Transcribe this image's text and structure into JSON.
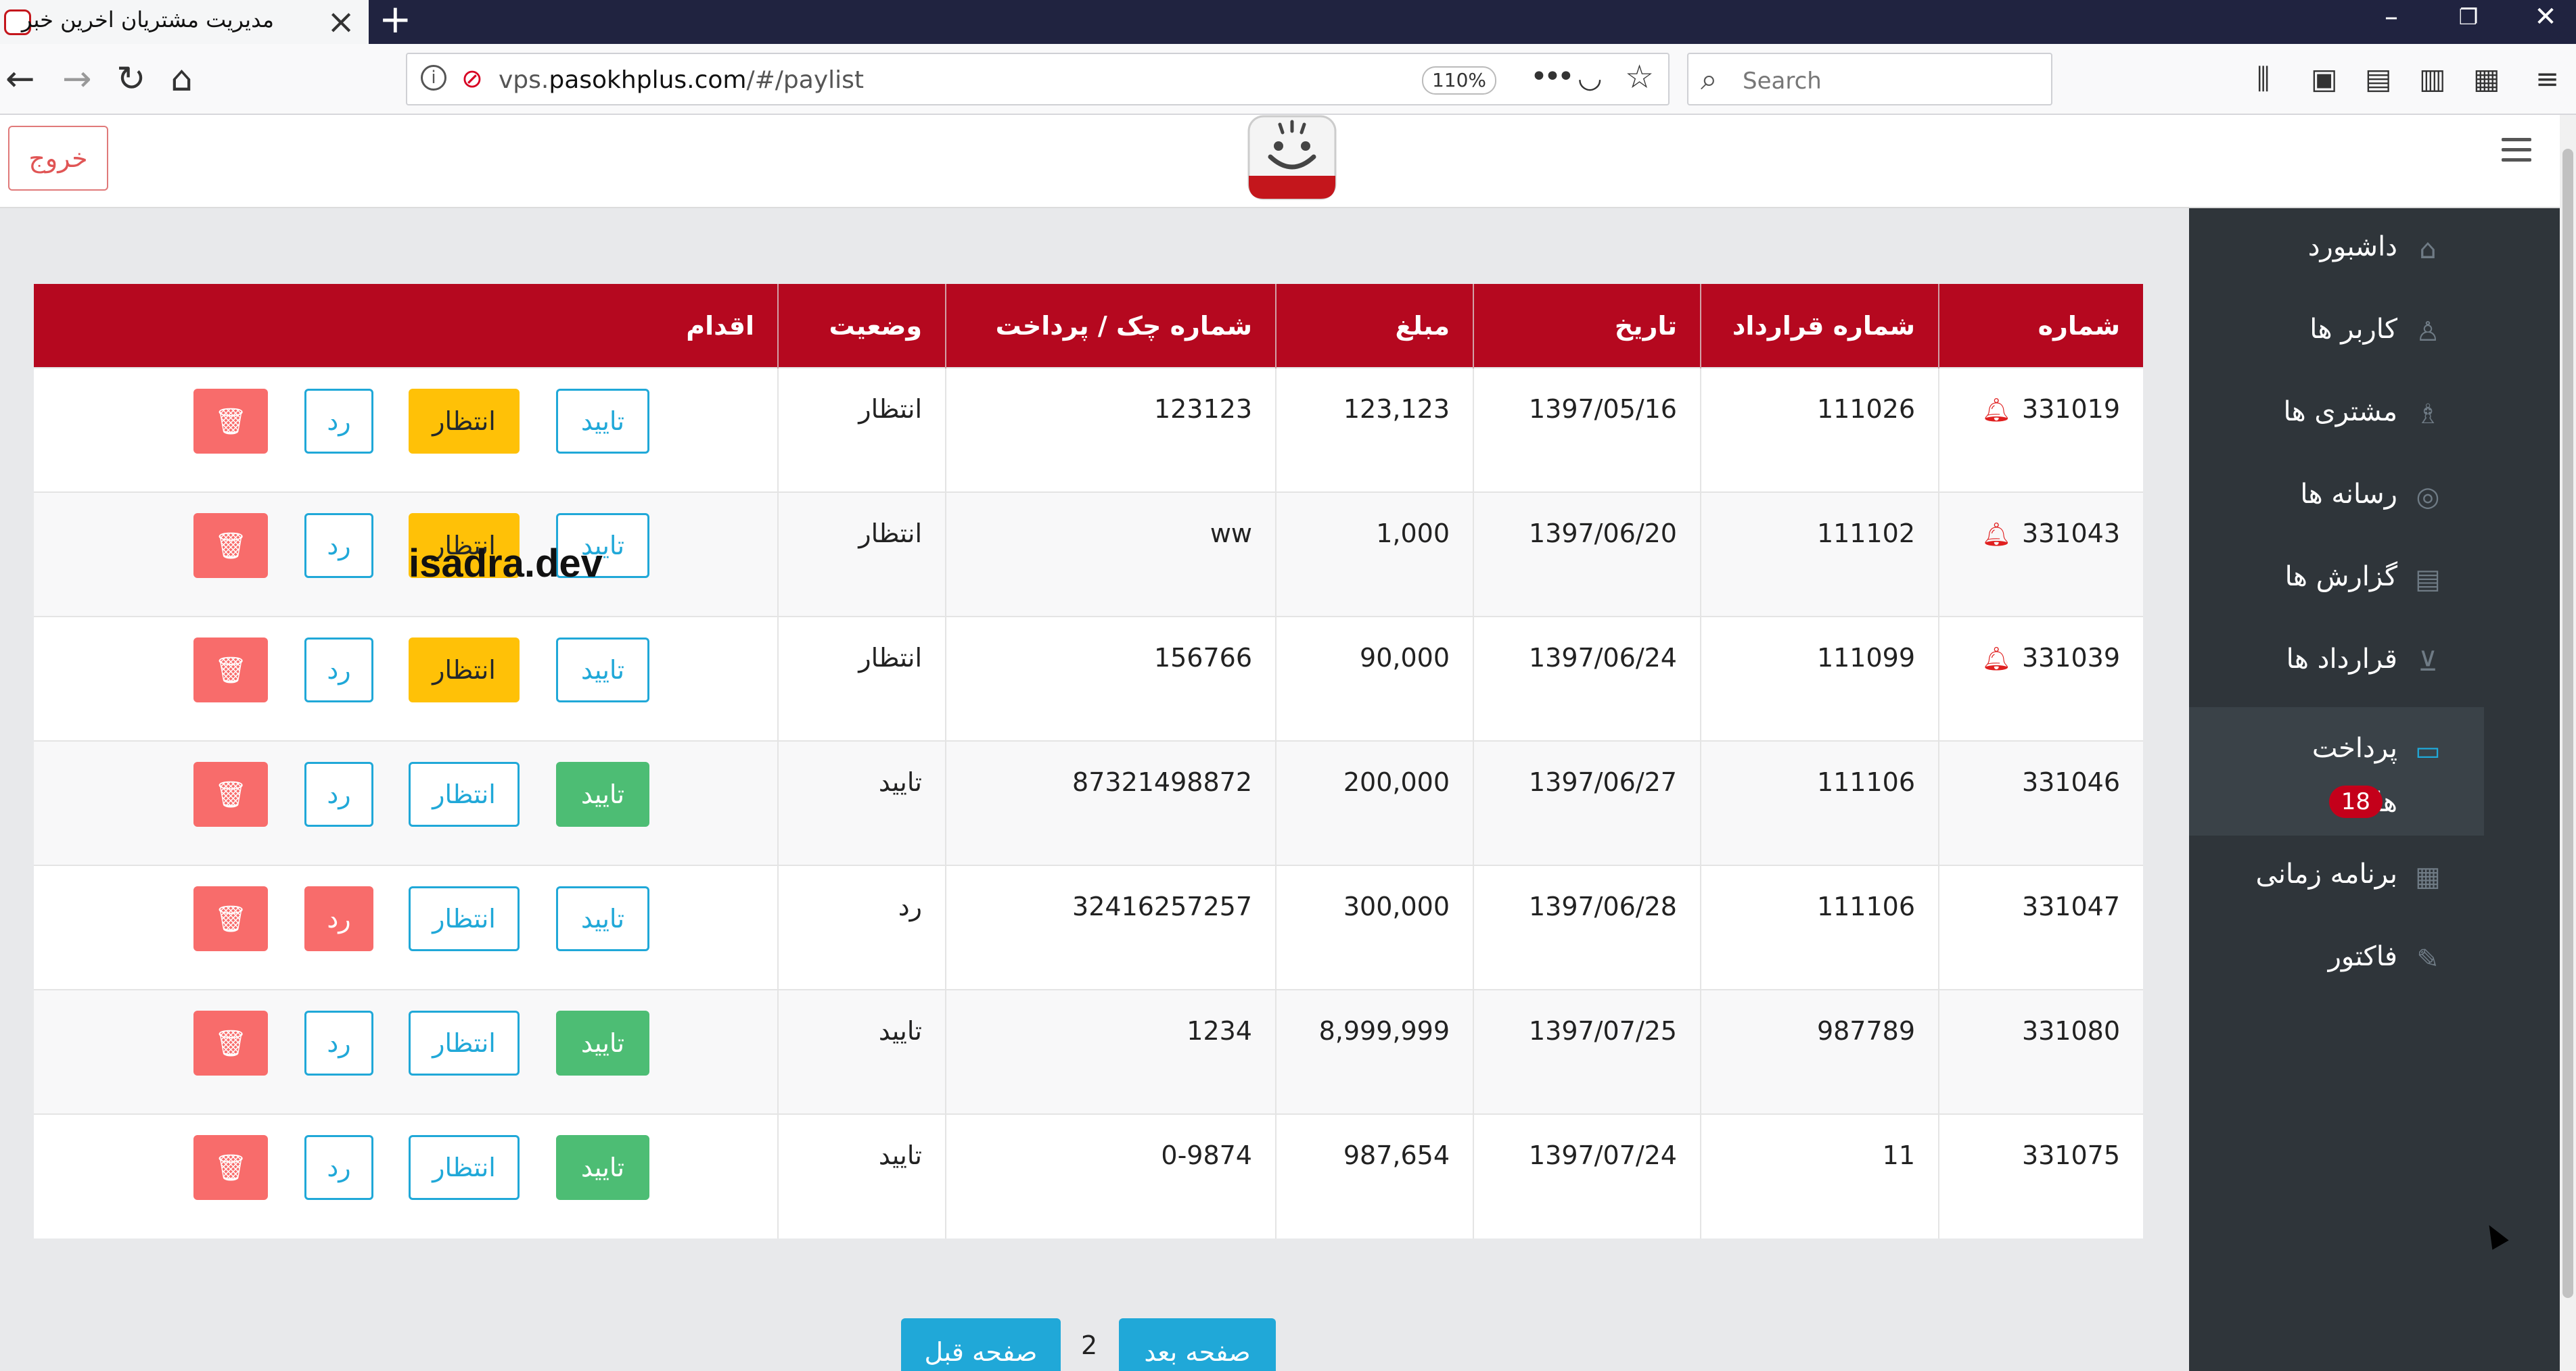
{
  "browser": {
    "tab_title": "مدیریت مشتریان اخرین خبر",
    "url_prefix": "vps.",
    "url_domain": "pasokhplus.com",
    "url_path": "/#/paylist",
    "zoom": "110%",
    "search_placeholder": "Search"
  },
  "header": {
    "logout_label": "خروج"
  },
  "sidebar": {
    "items": [
      {
        "label": "داشبورد",
        "icon": "home-icon"
      },
      {
        "label": "کاربر ها",
        "icon": "user-icon"
      },
      {
        "label": "مشتری ها",
        "icon": "users-icon"
      },
      {
        "label": "رسانه ها",
        "icon": "instagram-icon"
      },
      {
        "label": "گزارش ها",
        "icon": "book-icon"
      },
      {
        "label": "قرارداد ها",
        "icon": "cart-icon"
      },
      {
        "label": "پرداخت",
        "label2": "ها",
        "badge": "18",
        "icon": "credit-card-icon"
      },
      {
        "label": "برنامه زمانی",
        "icon": "calendar-icon"
      },
      {
        "label": "فاکتور",
        "icon": "edit-icon"
      }
    ]
  },
  "table": {
    "headers": [
      "شماره",
      "شماره قرارداد",
      "تاریخ",
      "مبلغ",
      "شماره چک / پرداخت",
      "وضعیت",
      "اقدام"
    ],
    "rows": [
      {
        "id": "331019",
        "bell": true,
        "contract": "111026",
        "date": "1397/05/16",
        "amount": "123,123",
        "check": "123123",
        "status": "انتظار"
      },
      {
        "id": "331043",
        "bell": true,
        "contract": "111102",
        "date": "1397/06/20",
        "amount": "1,000",
        "check": "ww",
        "status": "انتظار"
      },
      {
        "id": "331039",
        "bell": true,
        "contract": "111099",
        "date": "1397/06/24",
        "amount": "90,000",
        "check": "156766",
        "status": "انتظار"
      },
      {
        "id": "331046",
        "bell": false,
        "contract": "111106",
        "date": "1397/06/27",
        "amount": "200,000",
        "check": "87321498872",
        "status": "تایید"
      },
      {
        "id": "331047",
        "bell": false,
        "contract": "111106",
        "date": "1397/06/28",
        "amount": "300,000",
        "check": "32416257257",
        "status": "رد"
      },
      {
        "id": "331080",
        "bell": false,
        "contract": "987789",
        "date": "1397/07/25",
        "amount": "8,999,999",
        "check": "1234",
        "status": "تایید"
      },
      {
        "id": "331075",
        "bell": false,
        "contract": "11",
        "date": "1397/07/24",
        "amount": "987,654",
        "check": "0-9874",
        "status": "تایید"
      }
    ],
    "action_labels": {
      "approve": "تایید",
      "wait": "انتظار",
      "reject": "رد"
    }
  },
  "watermark": "isadra.dev",
  "pagination": {
    "prev_label": "صفحه قبل",
    "next_label": "صفحه بعد",
    "current_page": "2"
  },
  "colors": {
    "header_red": "#b5081f",
    "info": "#20a8d8",
    "success": "#4dbd74",
    "warning": "#ffc107",
    "danger": "#f86c6b"
  }
}
